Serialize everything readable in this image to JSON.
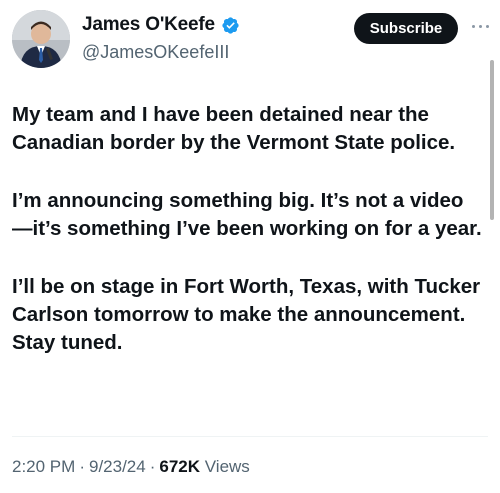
{
  "author": {
    "display_name": "James O'Keefe",
    "handle": "@JamesOKeefeIII",
    "verified": true
  },
  "actions": {
    "subscribe_label": "Subscribe"
  },
  "tweet": {
    "paragraphs": [
      "My team and I have been detained near the Canadian border by the Vermont State police.",
      "I’m announcing something big. It’s not a video—it’s something I’ve been working on for a year.",
      "I’ll be on stage in Fort Worth, Texas, with Tucker Carlson tomorrow to make the announcement. Stay tuned."
    ]
  },
  "meta": {
    "time": "2:20 PM",
    "date": "9/23/24",
    "views_count": "672K",
    "views_label": "Views"
  },
  "colors": {
    "verified_badge": "#1d9bf0",
    "subscribe_bg": "#0f1419",
    "secondary_text": "#536471"
  }
}
